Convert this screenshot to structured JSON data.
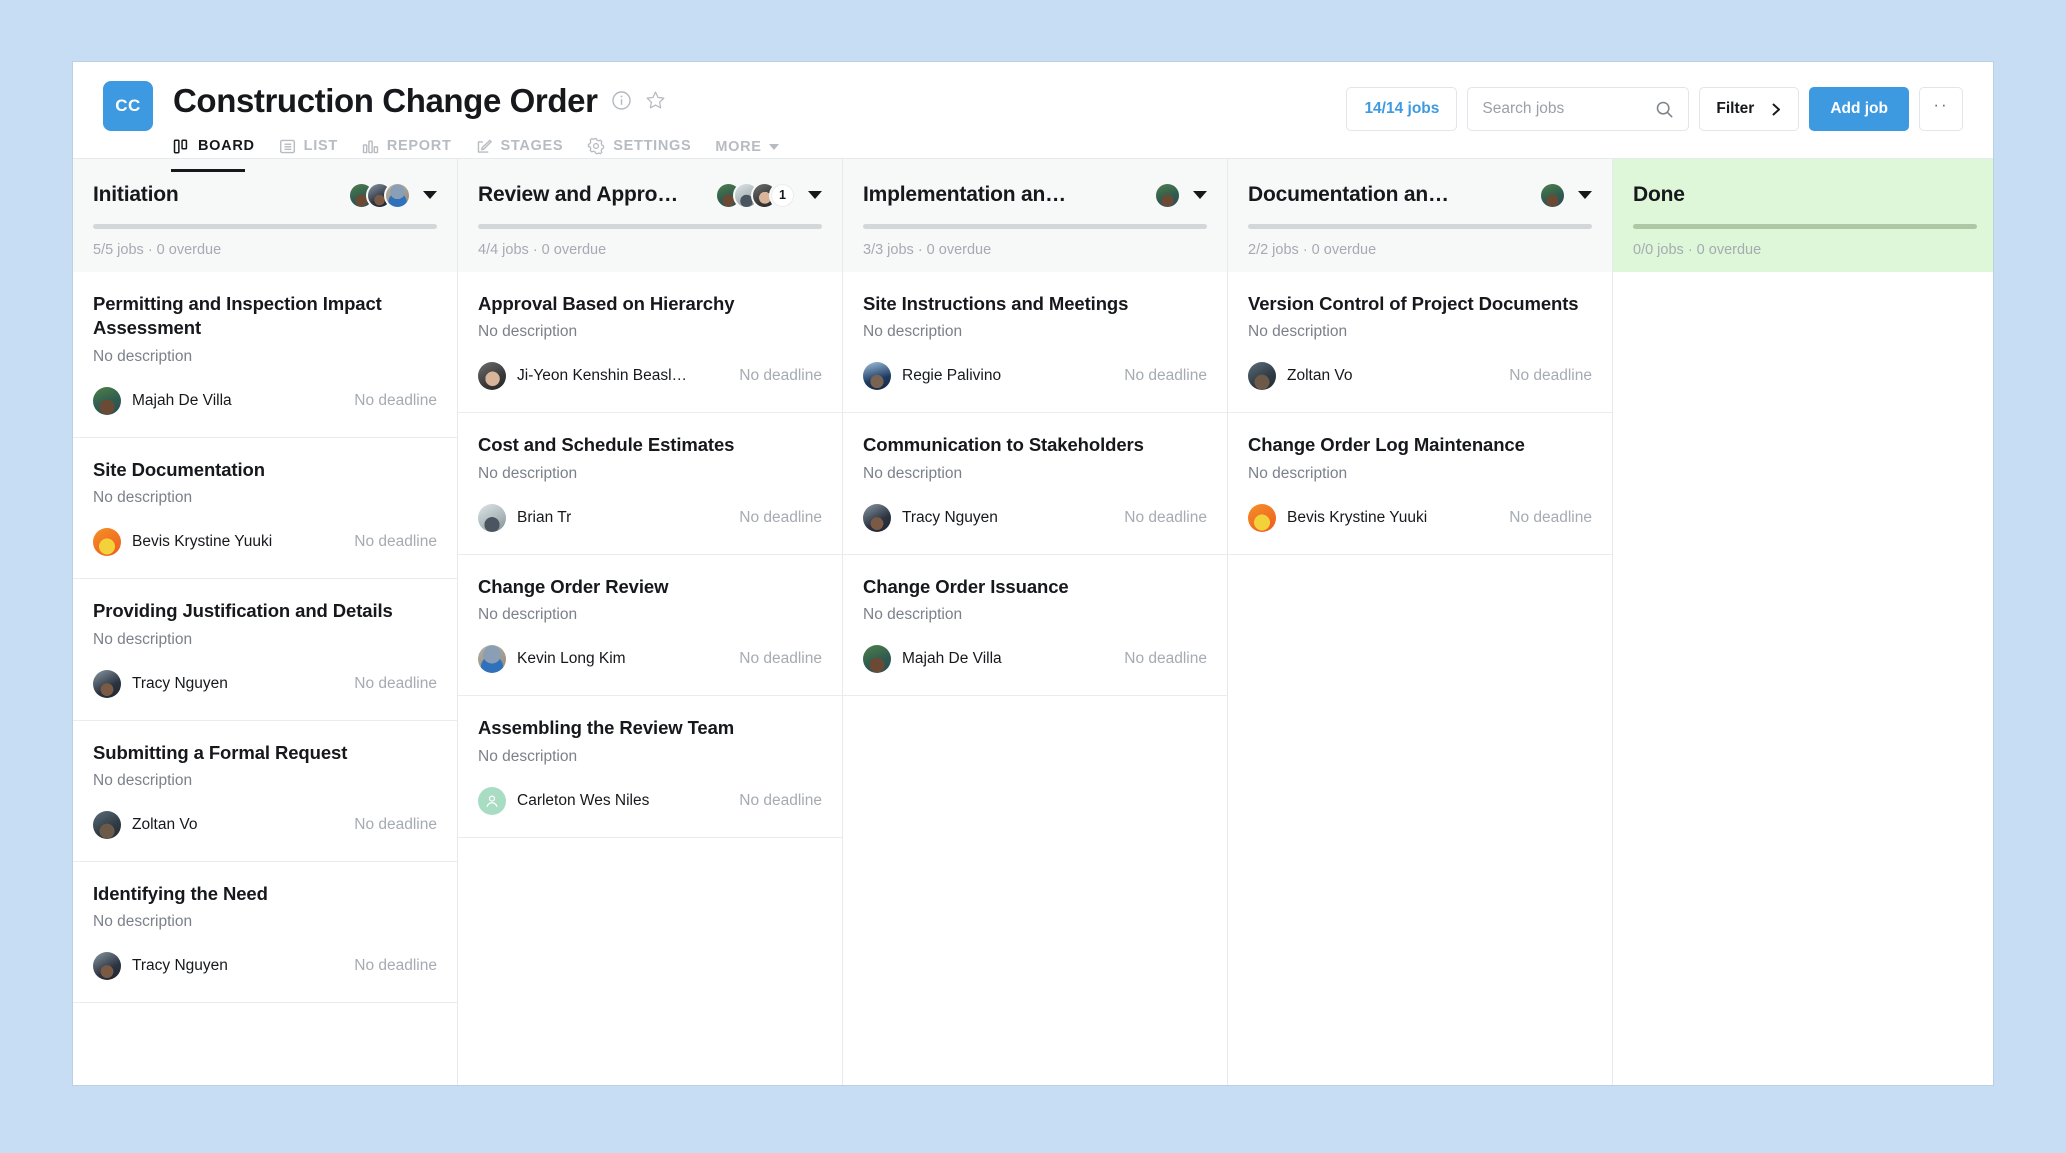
{
  "header": {
    "project_initials": "CC",
    "project_title": "Construction Change Order",
    "info_icon": "info-circle-icon",
    "star_icon": "star-outline-icon",
    "tabs": [
      {
        "label": "BOARD",
        "icon": "board-icon",
        "active": true
      },
      {
        "label": "LIST",
        "icon": "list-icon",
        "active": false
      },
      {
        "label": "REPORT",
        "icon": "report-icon",
        "active": false
      },
      {
        "label": "STAGES",
        "icon": "stages-icon",
        "active": false
      },
      {
        "label": "SETTINGS",
        "icon": "gear-icon",
        "active": false
      }
    ],
    "more_label": "MORE",
    "jobs_count_label": "14/14 jobs",
    "search_placeholder": "Search jobs",
    "search_value": "",
    "filter_label": "Filter",
    "add_job_label": "Add job",
    "overflow_label": "··"
  },
  "colors": {
    "accent": "#3d9ae0",
    "done_column_bg": "#ddf7d8",
    "column_header_bg": "#f7f8f8",
    "page_bg": "#c7ddf4"
  },
  "board": {
    "columns": [
      {
        "title": "Initiation",
        "meta": "5/5 jobs · 0 overdue",
        "avatars": [
          "majah",
          "tracy",
          "kevin"
        ],
        "extra_count": null,
        "is_done": false,
        "cards": [
          {
            "title": "Permitting and Inspection Impact Assessment",
            "description": "No description",
            "assignee": "Majah De Villa",
            "avatar": "majah",
            "deadline": "No deadline"
          },
          {
            "title": "Site Documentation",
            "description": "No description",
            "assignee": "Bevis Krystine Yuuki",
            "avatar": "bevis",
            "deadline": "No deadline"
          },
          {
            "title": "Providing Justification and Details",
            "description": "No description",
            "assignee": "Tracy Nguyen",
            "avatar": "tracy",
            "deadline": "No deadline"
          },
          {
            "title": "Submitting a Formal Request",
            "description": "No description",
            "assignee": "Zoltan Vo",
            "avatar": "zoltan",
            "deadline": "No deadline"
          },
          {
            "title": "Identifying the Need",
            "description": "No description",
            "assignee": "Tracy Nguyen",
            "avatar": "tracy",
            "deadline": "No deadline"
          }
        ]
      },
      {
        "title": "Review and Appro…",
        "meta": "4/4 jobs · 0 overdue",
        "avatars": [
          "majah",
          "brian",
          "jiyeon"
        ],
        "extra_count": "1",
        "is_done": false,
        "cards": [
          {
            "title": "Approval Based on Hierarchy",
            "description": "No description",
            "assignee": "Ji-Yeon Kenshin Beasl…",
            "avatar": "jiyeon",
            "deadline": "No deadline"
          },
          {
            "title": "Cost and Schedule Estimates",
            "description": "No description",
            "assignee": "Brian Tr",
            "avatar": "brian",
            "deadline": "No deadline"
          },
          {
            "title": "Change Order Review",
            "description": "No description",
            "assignee": "Kevin Long Kim",
            "avatar": "kevin",
            "deadline": "No deadline"
          },
          {
            "title": "Assembling the Review Team",
            "description": "No description",
            "assignee": "Carleton Wes Niles",
            "avatar": "placeholder",
            "deadline": "No deadline"
          }
        ]
      },
      {
        "title": "Implementation an…",
        "meta": "3/3 jobs · 0 overdue",
        "avatars": [
          "majah"
        ],
        "extra_count": null,
        "is_done": false,
        "cards": [
          {
            "title": "Site Instructions and Meetings",
            "description": "No description",
            "assignee": "Regie Palivino",
            "avatar": "regie",
            "deadline": "No deadline"
          },
          {
            "title": "Communication to Stakeholders",
            "description": "No description",
            "assignee": "Tracy Nguyen",
            "avatar": "tracy",
            "deadline": "No deadline"
          },
          {
            "title": "Change Order Issuance",
            "description": "No description",
            "assignee": "Majah De Villa",
            "avatar": "majah",
            "deadline": "No deadline"
          }
        ]
      },
      {
        "title": "Documentation an…",
        "meta": "2/2 jobs · 0 overdue",
        "avatars": [
          "majah"
        ],
        "extra_count": null,
        "is_done": false,
        "cards": [
          {
            "title": "Version Control of Project Documents",
            "description": "No description",
            "assignee": "Zoltan Vo",
            "avatar": "zoltan",
            "deadline": "No deadline"
          },
          {
            "title": "Change Order Log Maintenance",
            "description": "No description",
            "assignee": "Bevis Krystine Yuuki",
            "avatar": "bevis",
            "deadline": "No deadline"
          }
        ]
      },
      {
        "title": "Done",
        "meta": "0/0 jobs · 0 overdue",
        "avatars": [],
        "extra_count": null,
        "is_done": true,
        "cards": []
      }
    ]
  }
}
